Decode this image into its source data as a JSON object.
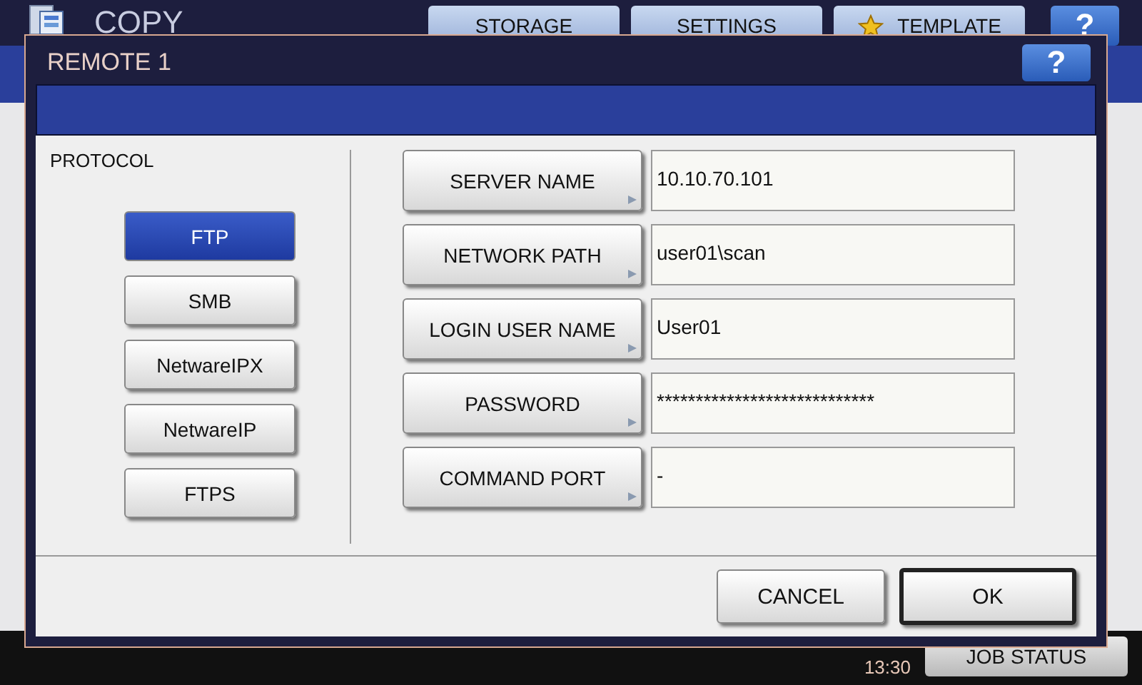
{
  "app": {
    "title": "COPY",
    "help": "?",
    "tabs": [
      {
        "label": "STORAGE",
        "kind": "plain"
      },
      {
        "label": "SETTINGS",
        "kind": "plain"
      },
      {
        "label": "TEMPLATE",
        "kind": "star"
      }
    ]
  },
  "dialog": {
    "title": "REMOTE 1",
    "help": "?",
    "protocol_label": "PROTOCOL",
    "protocols": [
      {
        "label": "FTP",
        "selected": true
      },
      {
        "label": "SMB",
        "selected": false
      },
      {
        "label": "NetwareIPX",
        "selected": false
      },
      {
        "label": "NetwareIP",
        "selected": false
      },
      {
        "label": "FTPS",
        "selected": false
      }
    ],
    "fields": [
      {
        "label": "SERVER NAME",
        "value": "10.10.70.101"
      },
      {
        "label": "NETWORK PATH",
        "value": "user01\\scan"
      },
      {
        "label": "LOGIN USER NAME",
        "value": "User01"
      },
      {
        "label": "PASSWORD",
        "value": "****************************"
      },
      {
        "label": "COMMAND PORT",
        "value": "-"
      }
    ],
    "buttons": [
      {
        "label": "CANCEL",
        "kind": "normal"
      },
      {
        "label": "OK",
        "kind": "default"
      }
    ]
  },
  "status": {
    "time": "13:30",
    "job_status": "JOB STATUS"
  }
}
